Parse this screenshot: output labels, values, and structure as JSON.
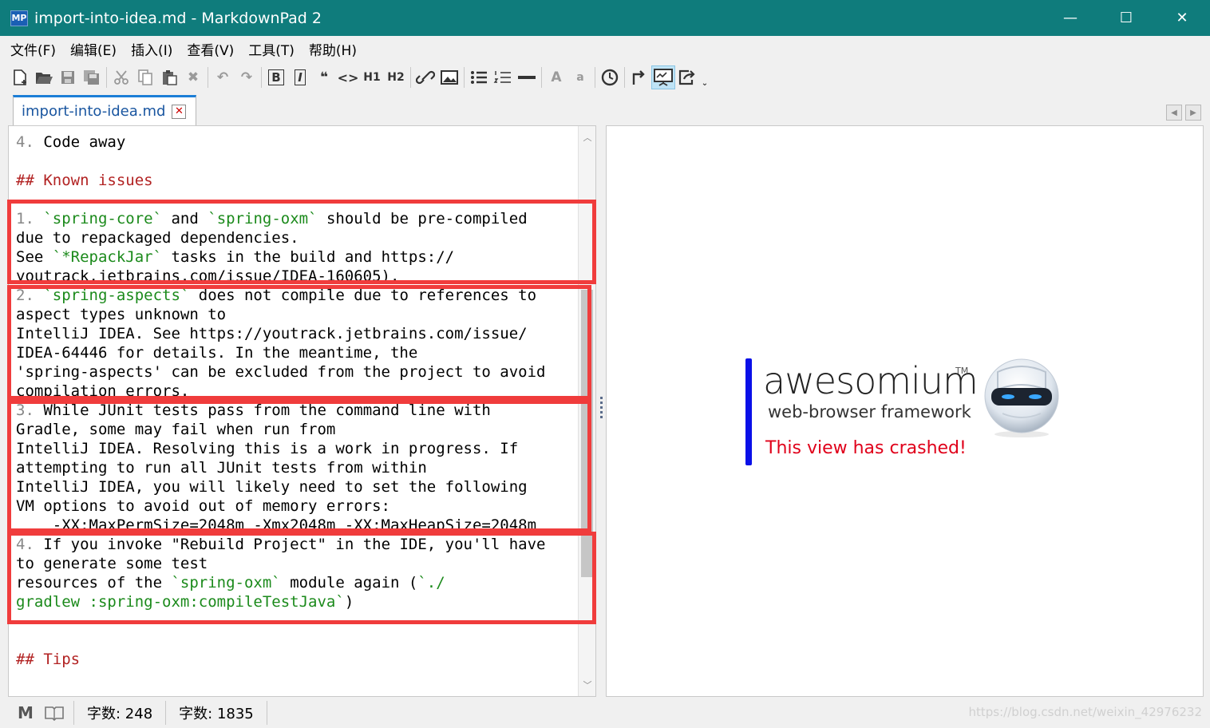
{
  "window": {
    "app_logo": "MP",
    "title": "import-into-idea.md - MarkdownPad 2",
    "controls": {
      "minimize": "—",
      "maximize": "☐",
      "close": "✕"
    }
  },
  "menu": [
    "文件(F)",
    "编辑(E)",
    "插入(I)",
    "查看(V)",
    "工具(T)",
    "帮助(H)"
  ],
  "toolbar": {
    "bold": "B",
    "italic": "I",
    "quote": "❝",
    "code": "<>",
    "h1": "H1",
    "h2": "H2",
    "font_up": "A",
    "font_down": "a"
  },
  "tab": {
    "label": "import-into-idea.md",
    "close": "✕"
  },
  "editor": {
    "lines": [
      [
        {
          "t": "4. ",
          "c": "gray"
        },
        {
          "t": "Code away"
        }
      ],
      [],
      [
        {
          "t": "## Known issues",
          "c": "red"
        }
      ],
      [],
      [
        {
          "t": "1. ",
          "c": "gray"
        },
        {
          "t": "`spring-core`",
          "c": "green"
        },
        {
          "t": " and "
        },
        {
          "t": "`spring-oxm`",
          "c": "green"
        },
        {
          "t": " should be pre-compiled"
        }
      ],
      [
        {
          "t": "due to repackaged dependencies."
        }
      ],
      [
        {
          "t": "See "
        },
        {
          "t": "`*RepackJar`",
          "c": "green"
        },
        {
          "t": " tasks in the build and https://"
        }
      ],
      [
        {
          "t": "youtrack.jetbrains.com/issue/IDEA-160605)."
        }
      ],
      [
        {
          "t": "2. ",
          "c": "gray"
        },
        {
          "t": "`spring-aspects`",
          "c": "green"
        },
        {
          "t": " does not compile due to references to"
        }
      ],
      [
        {
          "t": "aspect types unknown to"
        }
      ],
      [
        {
          "t": "IntelliJ IDEA. See https://youtrack.jetbrains.com/issue/"
        }
      ],
      [
        {
          "t": "IDEA-64446 for details. In the meantime, the"
        }
      ],
      [
        {
          "t": "'spring-aspects' can be excluded from the project to avoid"
        }
      ],
      [
        {
          "t": "compilation errors."
        }
      ],
      [
        {
          "t": "3. ",
          "c": "gray"
        },
        {
          "t": "While JUnit tests pass from the command line with"
        }
      ],
      [
        {
          "t": "Gradle, some may fail when run from"
        }
      ],
      [
        {
          "t": "IntelliJ IDEA. Resolving this is a work in progress. If"
        }
      ],
      [
        {
          "t": "attempting to run all JUnit tests from within"
        }
      ],
      [
        {
          "t": "IntelliJ IDEA, you will likely need to set the following"
        }
      ],
      [
        {
          "t": "VM options to avoid out of memory errors:"
        }
      ],
      [
        {
          "t": "    -XX:MaxPermSize=2048m -Xmx2048m -XX:MaxHeapSize=2048m"
        }
      ],
      [
        {
          "t": "4. ",
          "c": "gray"
        },
        {
          "t": "If you invoke \"Rebuild Project\" in the IDE, you'll have"
        }
      ],
      [
        {
          "t": "to generate some test"
        }
      ],
      [
        {
          "t": "resources of the "
        },
        {
          "t": "`spring-oxm`",
          "c": "green"
        },
        {
          "t": " module again ("
        },
        {
          "t": "`./",
          "c": "green"
        }
      ],
      [
        {
          "t": "gradlew :spring-oxm:compileTestJava`",
          "c": "green"
        },
        {
          "t": ")"
        }
      ],
      [],
      [],
      [
        {
          "t": "## Tips",
          "c": "red"
        }
      ]
    ]
  },
  "preview": {
    "brand": "awesomium",
    "tm": "TM",
    "tagline": "web-browser framework",
    "crash_message": "This view has crashed!"
  },
  "status": {
    "words_label": "字数: 248",
    "chars_label": "字数: 1835"
  },
  "watermark": "https://blog.csdn.net/weixin_42976232"
}
